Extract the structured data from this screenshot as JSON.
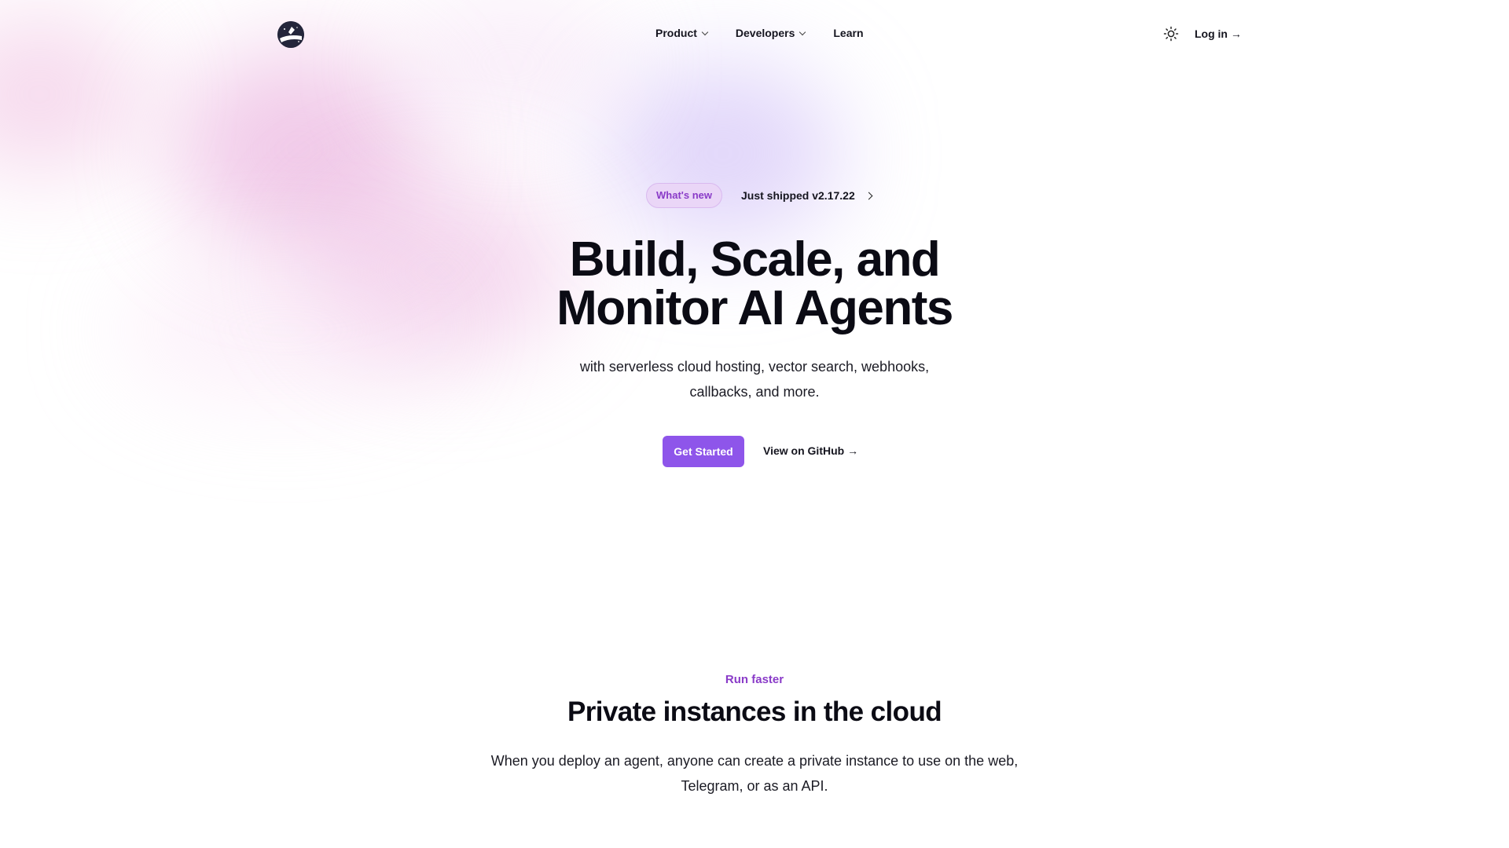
{
  "header": {
    "logo_alt": "rocket-logo",
    "nav": [
      {
        "label": "Product",
        "has_dropdown": true
      },
      {
        "label": "Developers",
        "has_dropdown": true
      },
      {
        "label": "Learn",
        "has_dropdown": false
      }
    ],
    "theme_icon": "sun-icon",
    "login_label": "Log in →"
  },
  "announcement": {
    "pill_label": "What's new",
    "text": "Just shipped v2.17.22",
    "icon": "chevron-right-icon"
  },
  "hero": {
    "title_line1": "Build, Scale, and",
    "title_line2": "Monitor AI Agents",
    "subtitle_line1": "with serverless cloud hosting, vector search, webhooks,",
    "subtitle_line2": "callbacks, and more.",
    "primary_cta": "Get Started",
    "secondary_cta": "View on GitHub →"
  },
  "section": {
    "eyebrow": "Run faster",
    "title": "Private instances in the cloud",
    "body_line1": "When you deploy an agent, anyone can create a private instance to use on the web,",
    "body_line2": "Telegram, or as an API."
  },
  "colors": {
    "accent": "#8e55ea",
    "accent_text": "#8a3bc8",
    "pill_bg": "#ead6f7",
    "text": "#0b0b14"
  }
}
